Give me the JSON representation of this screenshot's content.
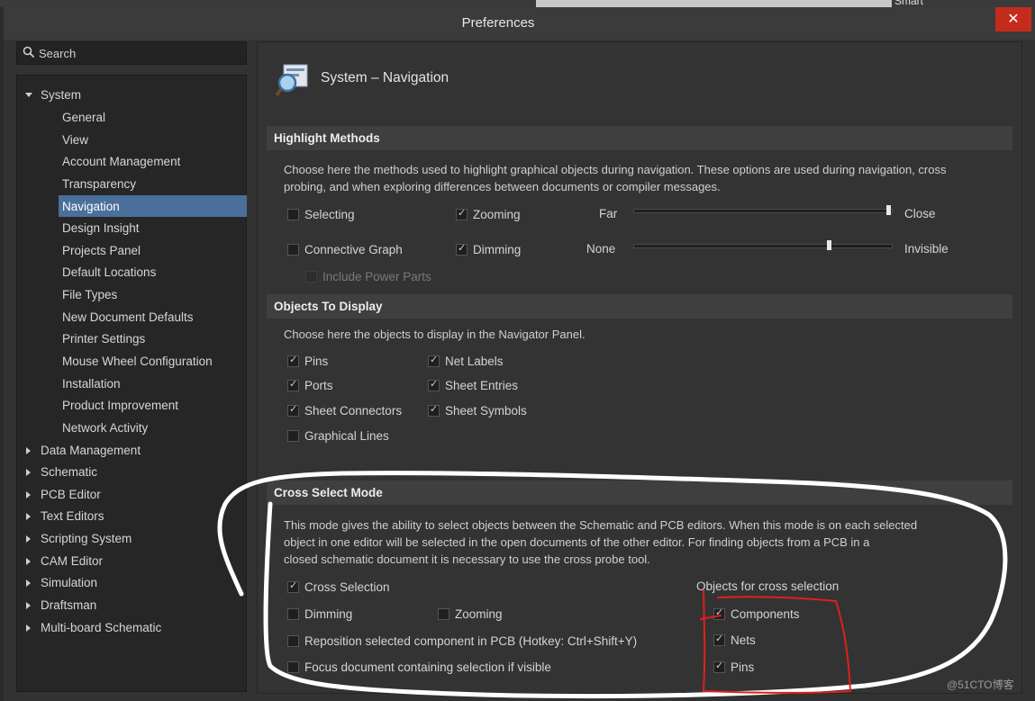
{
  "background": {
    "corner_text": "Smart"
  },
  "window": {
    "title": "Preferences",
    "close_symbol": "✕"
  },
  "search": {
    "label": "Search"
  },
  "tree": {
    "system": "System",
    "children": [
      "General",
      "View",
      "Account Management",
      "Transparency",
      "Navigation",
      "Design Insight",
      "Projects Panel",
      "Default Locations",
      "File Types",
      "New Document Defaults",
      "Printer Settings",
      "Mouse Wheel Configuration",
      "Installation",
      "Product Improvement",
      "Network Activity"
    ],
    "selected": "Navigation",
    "roots": [
      "Data Management",
      "Schematic",
      "PCB Editor",
      "Text Editors",
      "Scripting System",
      "CAM Editor",
      "Simulation",
      "Draftsman",
      "Multi-board Schematic"
    ]
  },
  "page": {
    "title": "System – Navigation",
    "icon": "navigation-magnifier-icon"
  },
  "highlight": {
    "header": "Highlight Methods",
    "desc1": "Choose here the methods used to highlight graphical objects during navigation. These options are used during navigation, cross",
    "desc2": "probing, and when exploring differences between documents or compiler messages.",
    "selecting": "Selecting",
    "zooming": "Zooming",
    "connective": "Connective Graph",
    "dimming": "Dimming",
    "power": "Include Power Parts",
    "far": "Far",
    "close": "Close",
    "none": "None",
    "invisible": "Invisible",
    "zoom_level": 0.99,
    "dim_level": 0.76
  },
  "objects": {
    "header": "Objects To Display",
    "desc": "Choose here the objects to display in the Navigator Panel.",
    "pins": "Pins",
    "ports": "Ports",
    "sheet_connectors": "Sheet Connectors",
    "graphical_lines": "Graphical Lines",
    "net_labels": "Net Labels",
    "sheet_entries": "Sheet Entries",
    "sheet_symbols": "Sheet Symbols"
  },
  "cross": {
    "header": "Cross Select Mode",
    "desc1": "This mode gives the ability to select objects between the Schematic and PCB editors.  When this mode is on each selected",
    "desc2": "object in one editor will be selected in the open documents of the other editor.  For finding objects from a PCB in a",
    "desc3": "closed schematic document it is necessary to use the cross probe tool.",
    "cross_selection": "Cross Selection",
    "dimming": "Dimming",
    "zooming": "Zooming",
    "reposition": "Reposition selected component in PCB (Hotkey: Ctrl+Shift+Y)",
    "focus": "Focus document containing selection if visible",
    "objects_title": "Objects for cross selection",
    "components": "Components",
    "nets": "Nets",
    "pins": "Pins"
  },
  "watermark": "@51CTO博客",
  "colors": {
    "selection": "#4a6f9a",
    "close_button": "#c42b1c",
    "annotation_white": "#ffffff",
    "annotation_red": "#e0201c"
  }
}
